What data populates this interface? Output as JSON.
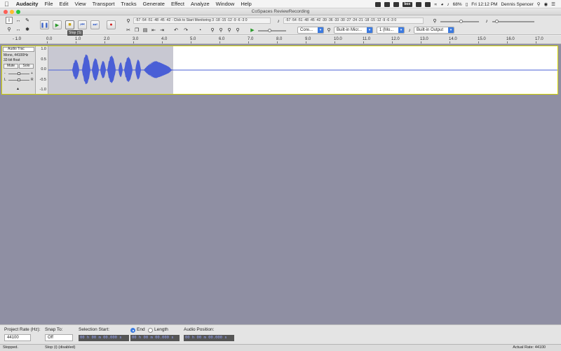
{
  "menubar": {
    "app_name": "Audacity",
    "menus": [
      "File",
      "Edit",
      "View",
      "Transport",
      "Tracks",
      "Generate",
      "Effect",
      "Analyze",
      "Window",
      "Help"
    ],
    "battery": "68%",
    "clock": "Fri 12:12 PM",
    "user": "Dennis Spencer",
    "box_label": "box"
  },
  "window": {
    "title": "CoSpaces ReviewRecording"
  },
  "toolbar": {
    "tooltip": "Stop (S)",
    "rec_meter_text": "-57 -54 -51 -48 -45 -42 -  Click to Start Monitoring  3 -18 -15 -12 -9 -6 -3 0",
    "play_meter_text": "-57 -54 -51 -48 -45 -42 -39 -36 -33 -30 -27 -24 -21 -18 -15 -12 -9 -6 -3 0",
    "host": "Core...",
    "input_device": "Built-in Micr...",
    "channels": "1 (Mo...",
    "output_device": "Built-in Output"
  },
  "ruler": {
    "zoom_label": "- 1.0",
    "ticks": [
      "0.0",
      "1.0",
      "2.0",
      "3.0",
      "4.0",
      "5.0",
      "6.0",
      "7.0",
      "8.0",
      "9.0",
      "10.0",
      "11.0",
      "12.0",
      "13.0",
      "14.0",
      "15.0",
      "16.0",
      "17.0"
    ]
  },
  "track": {
    "name": "Audio Trac",
    "info_line1": "Mono, 44100Hz",
    "info_line2": "32-bit float",
    "mute_label": "Mute",
    "solo_label": "Solo",
    "gain_minus": "-",
    "gain_plus": "+",
    "pan_left": "L",
    "pan_right": "R",
    "scale_labels": [
      "1.0",
      "0.5",
      "0.0",
      "-0.5",
      "-1.0"
    ]
  },
  "selection_bar": {
    "project_rate_label": "Project Rate (Hz):",
    "project_rate_value": "44100",
    "snap_to_label": "Snap To:",
    "snap_to_value": "Off",
    "selection_start_label": "Selection Start:",
    "end_label": "End",
    "length_label": "Length",
    "audio_position_label": "Audio Position:",
    "selection_start_value": "00 h 00 m 00.000 s",
    "selection_end_value": "00 h 00 m 00.000 s",
    "audio_position_value": "00 h 00 m 00.000 s"
  },
  "status_bar": {
    "state": "Stopped.",
    "hint": "Stop (i) (disabled)",
    "actual_rate": "Actual Rate: 44100"
  },
  "colors": {
    "waveform": "#4a5fd6",
    "track_bg": "#8f8fa3",
    "accent": "#3b7ae0"
  }
}
